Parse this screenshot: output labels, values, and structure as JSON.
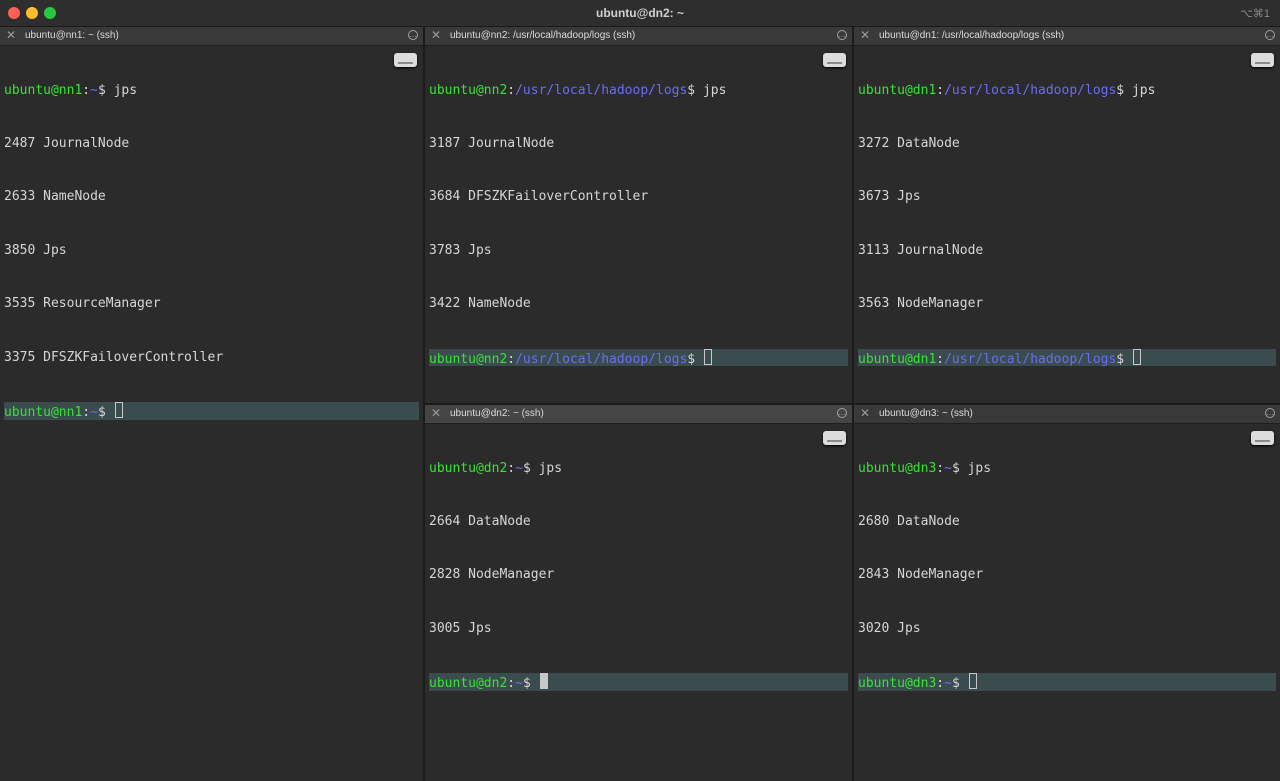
{
  "window": {
    "title": "ubuntu@dn2: ~",
    "shortcut": "⌥⌘1"
  },
  "panes": {
    "nn1": {
      "title": "ubuntu@nn1: ~ (ssh)",
      "close": "✕",
      "menu": "…",
      "cmd": {
        "user": "ubuntu@nn1",
        "sep": ":",
        "path": "~",
        "suffix": "$ jps"
      },
      "output": [
        "2487 JournalNode",
        "2633 NameNode",
        "3850 Jps",
        "3535 ResourceManager",
        "3375 DFSZKFailoverController"
      ],
      "prompt": {
        "user": "ubuntu@nn1",
        "sep": ":",
        "path": "~",
        "suffix": "$ "
      }
    },
    "nn2": {
      "title": "ubuntu@nn2: /usr/local/hadoop/logs (ssh)",
      "close": "✕",
      "menu": "…",
      "cmd": {
        "user": "ubuntu@nn2",
        "sep": ":",
        "path": "/usr/local/hadoop/logs",
        "suffix": "$ jps"
      },
      "output": [
        "3187 JournalNode",
        "3684 DFSZKFailoverController",
        "3783 Jps",
        "3422 NameNode"
      ],
      "prompt": {
        "user": "ubuntu@nn2",
        "sep": ":",
        "path": "/usr/local/hadoop/logs",
        "suffix": "$ "
      }
    },
    "dn1": {
      "title": "ubuntu@dn1: /usr/local/hadoop/logs (ssh)",
      "close": "✕",
      "menu": "…",
      "cmd": {
        "user": "ubuntu@dn1",
        "sep": ":",
        "path": "/usr/local/hadoop/logs",
        "suffix": "$ jps"
      },
      "output": [
        "3272 DataNode",
        "3673 Jps",
        "3113 JournalNode",
        "3563 NodeManager"
      ],
      "prompt": {
        "user": "ubuntu@dn1",
        "sep": ":",
        "path": "/usr/local/hadoop/logs",
        "suffix": "$ "
      }
    },
    "dn2": {
      "title": "ubuntu@dn2: ~ (ssh)",
      "close": "✕",
      "menu": "…",
      "cmd": {
        "user": "ubuntu@dn2",
        "sep": ":",
        "path": "~",
        "suffix": "$ jps"
      },
      "output": [
        "2664 DataNode",
        "2828 NodeManager",
        "3005 Jps"
      ],
      "prompt": {
        "user": "ubuntu@dn2",
        "sep": ":",
        "path": "~",
        "suffix": "$ "
      }
    },
    "dn3": {
      "title": "ubuntu@dn3: ~ (ssh)",
      "close": "✕",
      "menu": "…",
      "cmd": {
        "user": "ubuntu@dn3",
        "sep": ":",
        "path": "~",
        "suffix": "$ jps"
      },
      "output": [
        "2680 DataNode",
        "2843 NodeManager",
        "3020 Jps"
      ],
      "prompt": {
        "user": "ubuntu@dn3",
        "sep": ":",
        "path": "~",
        "suffix": "$ "
      }
    }
  },
  "colors": {
    "user": "#39e335",
    "path": "#6b6cf5",
    "text": "#d6d6d6",
    "prompt_highlight": "#3b4c4f"
  }
}
